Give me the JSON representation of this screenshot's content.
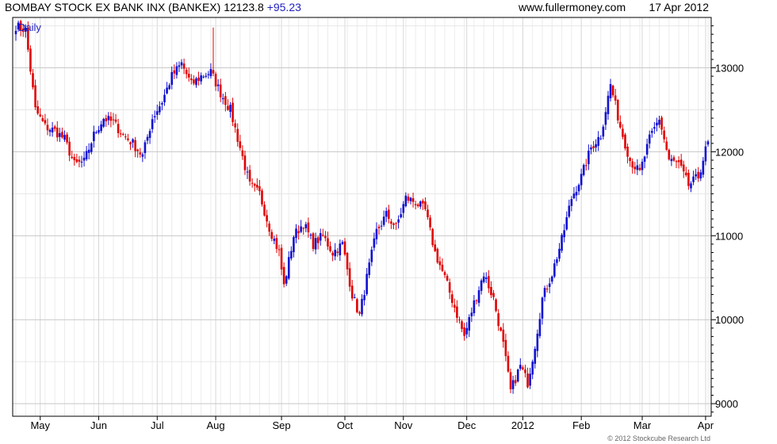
{
  "header": {
    "title": "BOMBAY STOCK EX BANK INX (BANKEX)",
    "last": "12123.8",
    "change": "+95.23",
    "site": "www.fullermoney.com",
    "date": "17 Apr 2012"
  },
  "copyright": "© 2012 Stockcube Research Ltd",
  "chart_data": {
    "type": "candlestick",
    "period_label": "Daily",
    "ylim": [
      8850,
      13600
    ],
    "y_ticks": [
      9000,
      10000,
      11000,
      12000,
      13000
    ],
    "x_tick_labels": [
      "May",
      "Jun",
      "Jul",
      "Aug",
      "Sep",
      "Oct",
      "Nov",
      "Dec",
      "2012",
      "Feb",
      "Mar",
      "Apr"
    ],
    "x_tick_positions": [
      10,
      34,
      58,
      82,
      109,
      135,
      159,
      185,
      208,
      232,
      257,
      283
    ],
    "grid": true,
    "colors": {
      "up": "#1010d0",
      "down": "#e00000",
      "grid": "#d8d8d8",
      "period": "#2020c0"
    },
    "anchors": [
      [
        0,
        13500
      ],
      [
        4,
        13450
      ],
      [
        8,
        12500
      ],
      [
        12,
        12300
      ],
      [
        16,
        12250
      ],
      [
        20,
        12150
      ],
      [
        24,
        11850
      ],
      [
        28,
        11880
      ],
      [
        32,
        12200
      ],
      [
        36,
        12400
      ],
      [
        40,
        12350
      ],
      [
        44,
        12200
      ],
      [
        48,
        12100
      ],
      [
        52,
        11950
      ],
      [
        56,
        12400
      ],
      [
        60,
        12600
      ],
      [
        64,
        12900
      ],
      [
        68,
        13050
      ],
      [
        72,
        12800
      ],
      [
        76,
        12900
      ],
      [
        80,
        12950
      ],
      [
        84,
        12700
      ],
      [
        88,
        12500
      ],
      [
        92,
        12050
      ],
      [
        96,
        11600
      ],
      [
        100,
        11500
      ],
      [
        104,
        11100
      ],
      [
        108,
        10800
      ],
      [
        110,
        10400
      ],
      [
        114,
        11000
      ],
      [
        118,
        11150
      ],
      [
        122,
        10900
      ],
      [
        126,
        11000
      ],
      [
        130,
        10800
      ],
      [
        134,
        10900
      ],
      [
        138,
        10300
      ],
      [
        141,
        10050
      ],
      [
        144,
        10500
      ],
      [
        148,
        11050
      ],
      [
        152,
        11250
      ],
      [
        156,
        11100
      ],
      [
        160,
        11450
      ],
      [
        164,
        11400
      ],
      [
        168,
        11300
      ],
      [
        172,
        10800
      ],
      [
        176,
        10500
      ],
      [
        180,
        10150
      ],
      [
        184,
        9800
      ],
      [
        188,
        10200
      ],
      [
        192,
        10550
      ],
      [
        196,
        10250
      ],
      [
        200,
        9700
      ],
      [
        203,
        9150
      ],
      [
        207,
        9450
      ],
      [
        210,
        9250
      ],
      [
        213,
        9700
      ],
      [
        216,
        10250
      ],
      [
        220,
        10550
      ],
      [
        224,
        10950
      ],
      [
        228,
        11450
      ],
      [
        232,
        11700
      ],
      [
        236,
        12050
      ],
      [
        240,
        12200
      ],
      [
        244,
        12800
      ],
      [
        248,
        12300
      ],
      [
        252,
        11900
      ],
      [
        256,
        11750
      ],
      [
        260,
        12150
      ],
      [
        264,
        12400
      ],
      [
        268,
        11900
      ],
      [
        272,
        11850
      ],
      [
        276,
        11600
      ],
      [
        280,
        11700
      ],
      [
        284,
        12123.8
      ]
    ]
  }
}
